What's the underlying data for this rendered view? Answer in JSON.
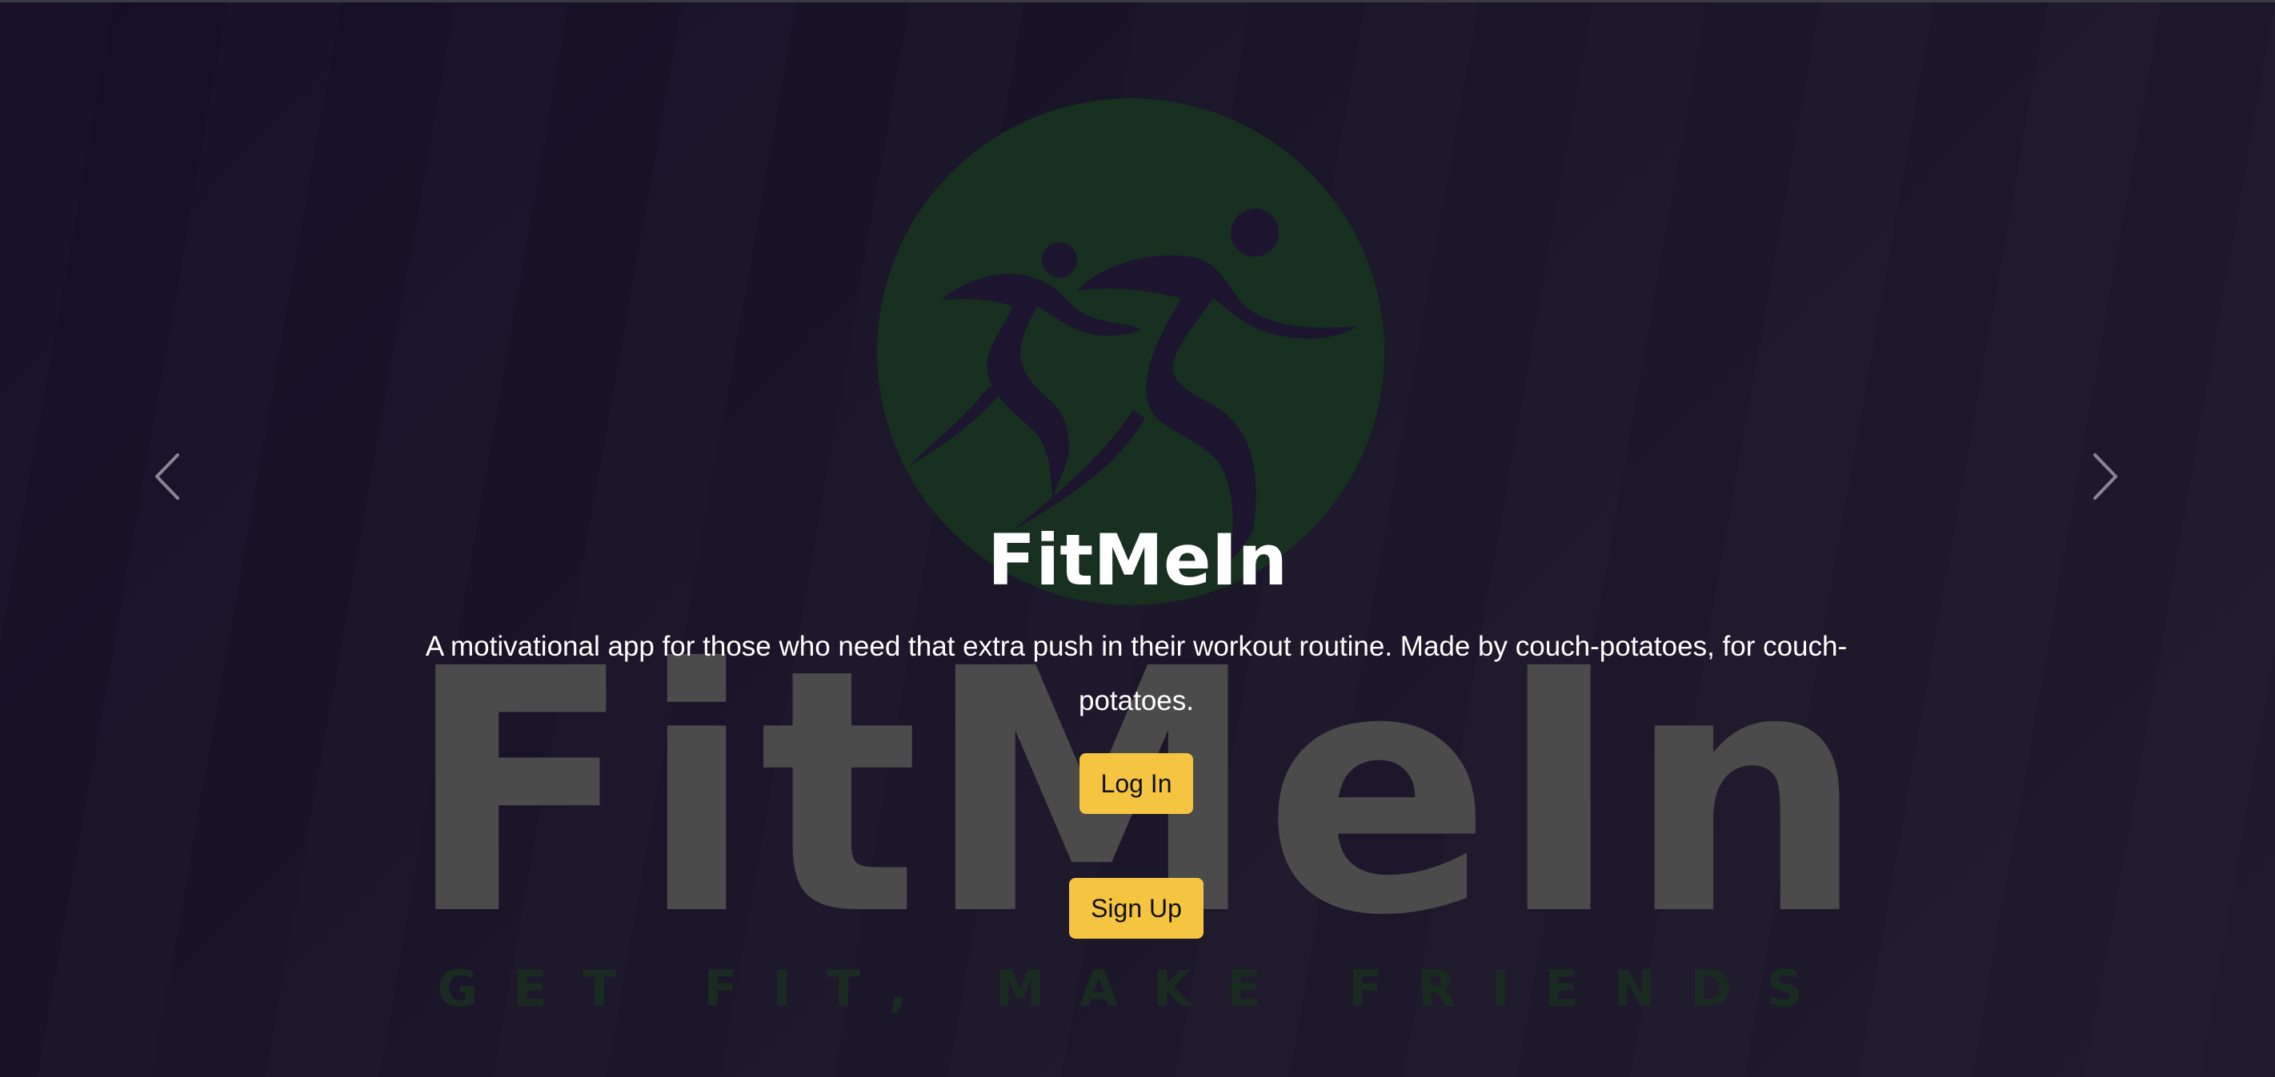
{
  "hero": {
    "title": "FitMeIn",
    "description": "A motivational app for those who need that extra push in their workout routine. Made by couch-potatoes, for couch-potatoes.",
    "watermark_text": "FitMeIn",
    "watermark_tagline": "GET FIT, MAKE FRIENDS"
  },
  "buttons": {
    "login_label": "Log In",
    "signup_label": "Sign Up"
  },
  "carousel": {
    "prev_icon": "chevron-left-icon",
    "next_icon": "chevron-right-icon"
  },
  "colors": {
    "background": "#1b1529",
    "button": "#f5c542",
    "logo_circle": "#17301f",
    "watermark": "#4b4b4b"
  }
}
